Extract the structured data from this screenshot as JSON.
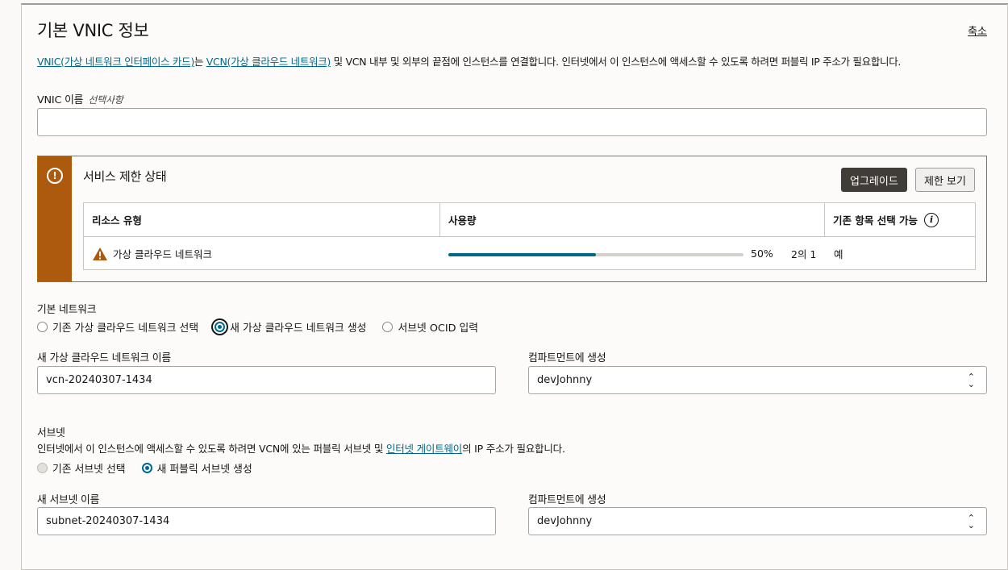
{
  "header": {
    "title": "기본 VNIC 정보",
    "collapse_label": "축소"
  },
  "description": {
    "link1": "VNIC(가상 네트워크 인터페이스 카드)",
    "text1": "는 ",
    "link2": "VCN(가상 클라우드 네트워크)",
    "text2": " 및 VCN 내부 및 외부의 끝점에 인스턴스를 연결합니다. 인터넷에서 이 인스턴스에 액세스할 수 있도록 하려면 퍼블릭 IP 주소가 필요합니다."
  },
  "vnic_name": {
    "label": "VNIC 이름",
    "optional": "선택사항",
    "value": ""
  },
  "service_limit": {
    "title": "서비스 제한 상태",
    "upgrade_button": "업그레이드",
    "view_limits_button": "제한 보기",
    "columns": [
      "리소스 유형",
      "사용량",
      "기존 항목 선택 가능"
    ],
    "row": {
      "resource": "가상 클라우드 네트워크",
      "usage_percent": 50,
      "usage_label": "50%",
      "usage_count": "2의 1",
      "existing": "예"
    }
  },
  "primary_network": {
    "label": "기본 네트워크",
    "options": [
      "기존 가상 클라우드 네트워크 선택",
      "새 가상 클라우드 네트워크 생성",
      "서브넷 OCID 입력"
    ],
    "selected_index": 1
  },
  "new_vcn": {
    "name_label": "새 가상 클라우드 네트워크 이름",
    "name_value": "vcn-20240307-1434",
    "compartment_label": "컴파트먼트에 생성",
    "compartment_value": "devJohnny"
  },
  "subnet": {
    "label": "서브넷",
    "desc_text1": "인터넷에서 이 인스턴스에 액세스할 수 있도록 하려면 VCN에 있는 퍼블릭 서브넷 및 ",
    "desc_link": "인터넷 게이트웨이",
    "desc_text2": "의 IP 주소가 필요합니다.",
    "options": [
      "기존 서브넷 선택",
      "새 퍼블릭 서브넷 생성"
    ],
    "selected_index": 1,
    "name_label": "새 서브넷 이름",
    "name_value": "subnet-20240307-1434",
    "compartment_label": "컴파트먼트에 생성",
    "compartment_value": "devJohnny"
  },
  "colors": {
    "link": "#00688c",
    "warning_strip": "#ad5a0f",
    "progress_fill": "#00688c"
  }
}
